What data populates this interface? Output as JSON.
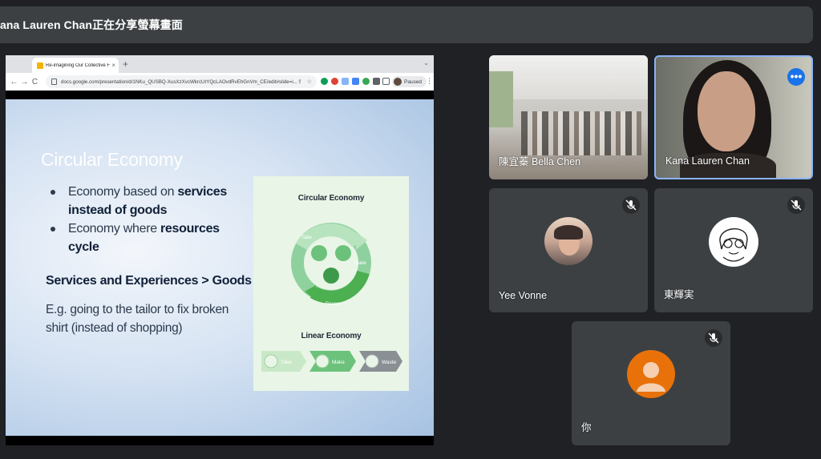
{
  "banner": {
    "text": "ana Lauren Chan正在分享螢幕畫面"
  },
  "browser": {
    "tab_title": "Re-imagining Our Collective F",
    "tab_close": "×",
    "new_tab": "+",
    "tab_menu": "⌄",
    "url": "docs.google.com/presentation/d/1NKu_QUSBQ-XusXzXvcWkrcUtYQcLAOvdRvEhGnVm_CE/edit#slide=i...",
    "paused_label": "Paused",
    "nav": {
      "back": "←",
      "forward": "→",
      "reload": "C"
    }
  },
  "slide": {
    "title": "Circular Economy",
    "bullet1_pre": "Economy based on ",
    "bullet1_bold": "services instead of goods",
    "bullet2_pre": "Economy where ",
    "bullet2_bold": "resources cycle",
    "subhead": "Services and Experiences > Goods",
    "example": "E.g. going to the tailor to fix broken shirt (instead of shopping)",
    "diagram": {
      "circular_title": "Circular Economy",
      "cycle_labels": [
        "Take",
        "Make",
        "Reuse"
      ],
      "linear_title": "Linear Economy",
      "linear_steps": [
        "Take",
        "Make",
        "Waste"
      ]
    }
  },
  "participants": [
    {
      "name": "陳宜蓁 Bella Chen"
    },
    {
      "name": "Kana Lauren Chan",
      "more": "•••"
    },
    {
      "name": "Yee Vonne"
    },
    {
      "name": "東輝実"
    },
    {
      "name": "你"
    }
  ],
  "colors": {
    "accent": "#1a73e8",
    "tile_bg": "#3c4043",
    "bg": "#202124",
    "self_avatar": "#e8710a"
  }
}
